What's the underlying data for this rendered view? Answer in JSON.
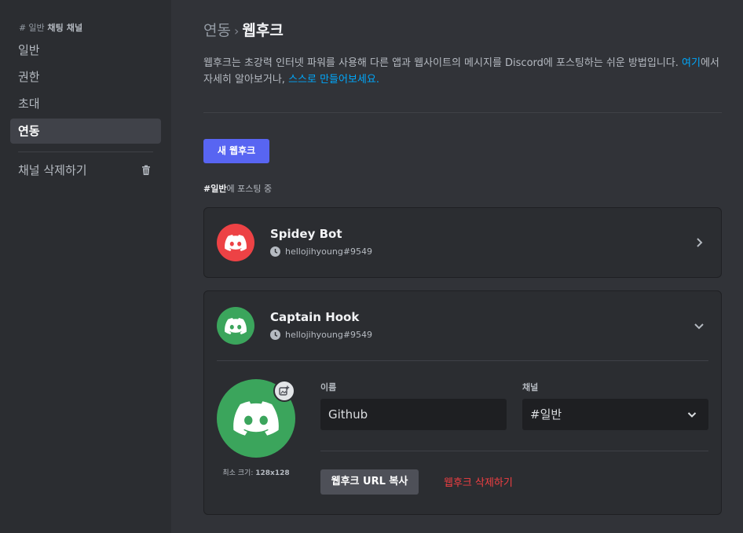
{
  "sidebar": {
    "header_hash": "#",
    "header_channel": "일반",
    "header_suffix": "채팅 채널",
    "items": [
      {
        "label": "일반"
      },
      {
        "label": "권한"
      },
      {
        "label": "초대"
      },
      {
        "label": "연동"
      }
    ],
    "delete_label": "채널 삭제하기"
  },
  "main": {
    "breadcrumb_parent": "연동",
    "breadcrumb_sep": "›",
    "breadcrumb_current": "웹후크",
    "description_before": "웹후크는 초강력 인터넷 파워를 사용해 다른 앱과 웹사이트의 메시지를 Discord에 포스팅하는 쉬운 방법입니다. ",
    "description_link1": "여기",
    "description_middle": "에서 자세히 알아보거나, ",
    "description_link2": "스스로 만들어보세요.",
    "new_button": "새 웹후크",
    "posting_channel": "#일반",
    "posting_suffix": "에 포스팅 중"
  },
  "webhooks": [
    {
      "name": "Spidey Bot",
      "creator": "hellojihyoung#9549",
      "avatar_color": "#ed4245"
    },
    {
      "name": "Captain Hook",
      "creator": "hellojihyoung#9549",
      "avatar_color": "#3ba55c"
    }
  ],
  "editor": {
    "min_size_label": "최소 크기: ",
    "min_size_value": "128x128",
    "name_label": "이름",
    "name_value": "Github",
    "channel_label": "채널",
    "channel_value": "#일반",
    "copy_url_button": "웹후크 URL 복사",
    "delete_button": "웹후크 삭제하기"
  },
  "colors": {
    "accent": "#5865f2",
    "link": "#00a8fc",
    "danger": "#f23f42"
  }
}
